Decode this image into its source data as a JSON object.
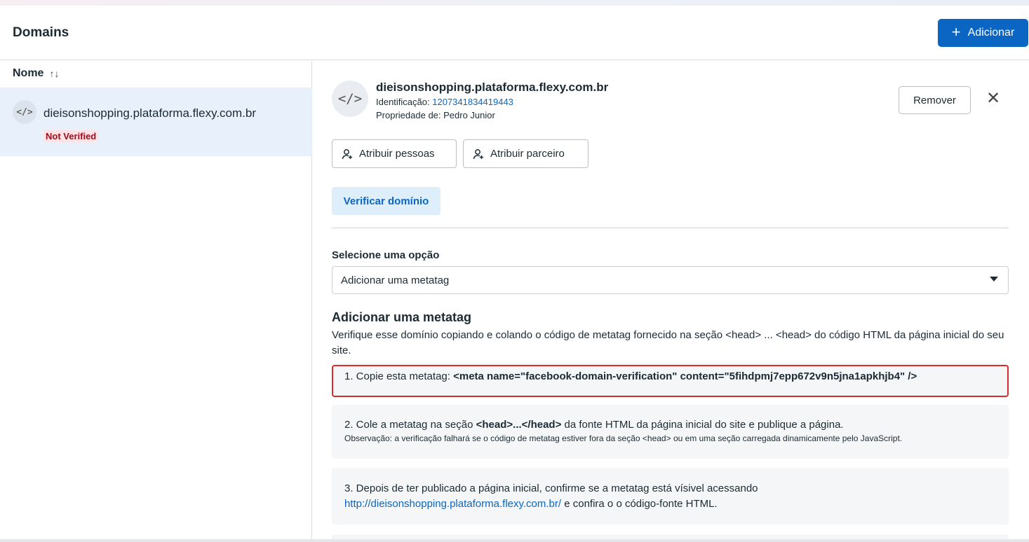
{
  "header": {
    "title": "Domains",
    "add_label": "Adicionar"
  },
  "list": {
    "sort_label": "Nome",
    "items": [
      {
        "name": "dieisonshopping.plataforma.flexy.com.br",
        "badge": "Not Verified"
      }
    ]
  },
  "detail": {
    "name": "dieisonshopping.plataforma.flexy.com.br",
    "id_label": "Identificação:",
    "id_value": "1207341834419443",
    "owner": "Propriedade de: Pedro Junior",
    "remove_label": "Remover",
    "assign_people_label": "Atribuir pessoas",
    "assign_partner_label": "Atribuir parceiro",
    "verify_label": "Verificar domínio",
    "select_label": "Selecione uma opção",
    "select_value": "Adicionar uma metatag",
    "section_title": "Adicionar uma metatag",
    "section_desc": "Verifique esse domínio copiando e colando o código de metatag fornecido na seção <head> ... <head> do código HTML da página inicial do seu site.",
    "step1_prefix": "1. Copie esta metatag: ",
    "step1_code": "<meta name=\"facebook-domain-verification\" content=\"5fihdpmj7epp672v9n5jna1apkhjb4\" />",
    "step2_prefix": "2. Cole a metatag na seção ",
    "step2_code": "<head>...</head>",
    "step2_suffix": " da fonte HTML da página inicial do site e publique a página.",
    "step2_note": "Observação: a verificação falhará se o código de metatag estiver fora da seção <head> ou em uma seção carregada dinamicamente pelo JavaScript.",
    "step3_text": "3. Depois de ter publicado a página inicial, confirme se a metatag está vísivel acessando",
    "step3_link": "http://dieisonshopping.plataforma.flexy.com.br/",
    "step3_suffix": " e confira o o código-fonte HTML."
  },
  "colors": {
    "primary": "#0a66c2",
    "badge_text": "#9a0c1a",
    "badge_bg": "#fbe3e6",
    "highlight_border": "#d92b2b",
    "selected_row": "#e7f0fb"
  },
  "icons": [
    "plus-icon",
    "sort-icon",
    "code-icon",
    "close-icon",
    "add-person-icon",
    "chevron-down-icon"
  ]
}
